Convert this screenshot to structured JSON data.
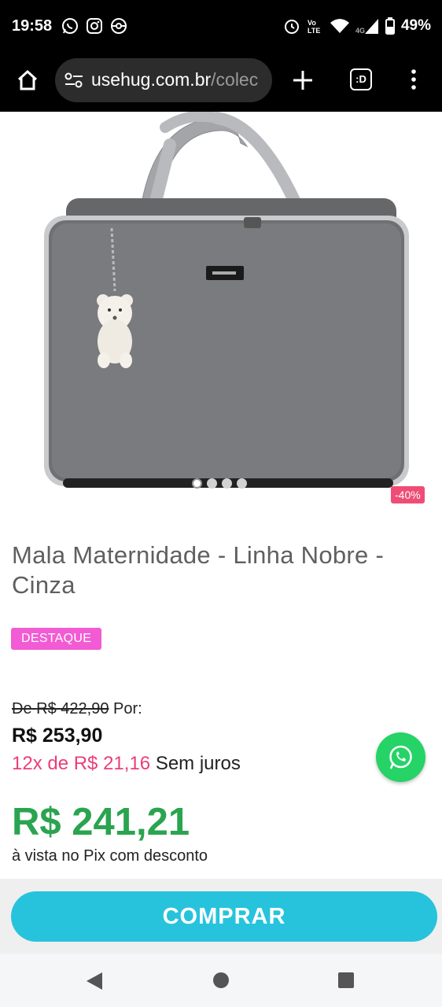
{
  "status_bar": {
    "time": "19:58",
    "battery": "49%",
    "icons": [
      "whatsapp-icon",
      "instagram-icon",
      "pokeball-icon",
      "alarm-icon",
      "volte-icon",
      "wifi-icon",
      "signal-icon",
      "battery-icon"
    ]
  },
  "browser": {
    "url_main": "usehug.com.br",
    "url_rest": "/colec"
  },
  "product": {
    "discount": "-40%",
    "title": "Mala Maternidade - Linha Nobre - Cinza",
    "badge": "DESTAQUE",
    "old_price_prefix": "De",
    "old_price": "R$ 422,90",
    "old_price_suffix": "Por:",
    "price": "R$ 253,90",
    "installments_highlight": "12x de R$ 21,16",
    "installments_suffix": "Sem juros",
    "pix_price": "R$ 241,21",
    "pix_note": "à vista no Pix com desconto",
    "image_count": 4,
    "active_image": 1
  },
  "actions": {
    "buy_label": "COMPRAR"
  },
  "colors": {
    "discount": "#ef4d76",
    "badge": "#f25bd3",
    "installments": "#ec3d78",
    "pix": "#2aa44f",
    "buy_button": "#27c3dc",
    "whatsapp": "#25d366"
  }
}
